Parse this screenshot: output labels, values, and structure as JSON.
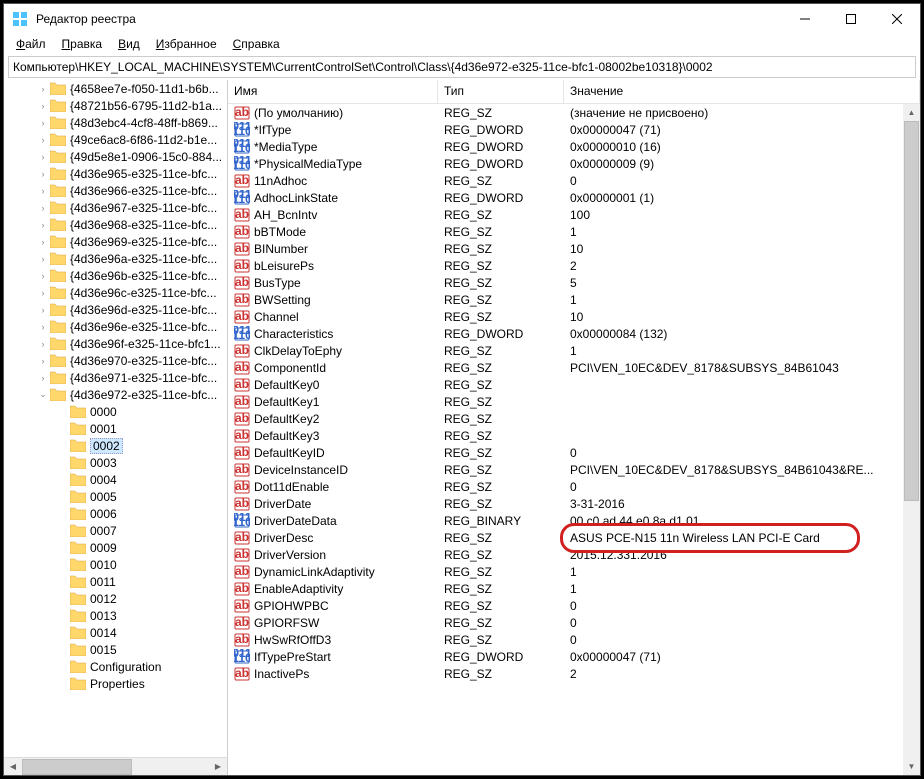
{
  "window": {
    "title": "Редактор реестра"
  },
  "menu": {
    "file": "Файл",
    "edit": "Правка",
    "view": "Вид",
    "favorites": "Избранное",
    "help": "Справка"
  },
  "address": "Компьютер\\HKEY_LOCAL_MACHINE\\SYSTEM\\CurrentControlSet\\Control\\Class\\{4d36e972-e325-11ce-bfc1-08002be10318}\\0002",
  "tree": {
    "folders": [
      "{4658ee7e-f050-11d1-b6b...",
      "{48721b56-6795-11d2-b1a...",
      "{48d3ebc4-4cf8-48ff-b869...",
      "{49ce6ac8-6f86-11d2-b1e...",
      "{49d5e8e1-0906-15c0-884...",
      "{4d36e965-e325-11ce-bfc...",
      "{4d36e966-e325-11ce-bfc...",
      "{4d36e967-e325-11ce-bfc...",
      "{4d36e968-e325-11ce-bfc...",
      "{4d36e969-e325-11ce-bfc...",
      "{4d36e96a-e325-11ce-bfc...",
      "{4d36e96b-e325-11ce-bfc...",
      "{4d36e96c-e325-11ce-bfc...",
      "{4d36e96d-e325-11ce-bfc...",
      "{4d36e96e-e325-11ce-bfc...",
      "{4d36e96f-e325-11ce-bfc1...",
      "{4d36e970-e325-11ce-bfc...",
      "{4d36e971-e325-11ce-bfc...",
      "{4d36e972-e325-11ce-bfc..."
    ],
    "subs": [
      "0000",
      "0001",
      "0002",
      "0003",
      "0004",
      "0005",
      "0006",
      "0007",
      "0009",
      "0010",
      "0011",
      "0012",
      "0013",
      "0014",
      "0015",
      "Configuration",
      "Properties"
    ],
    "selected_sub": "0002"
  },
  "columns": {
    "name": "Имя",
    "type": "Тип",
    "value": "Значение"
  },
  "values": [
    {
      "icon": "sz",
      "name": "(По умолчанию)",
      "type": "REG_SZ",
      "value": "(значение не присвоено)"
    },
    {
      "icon": "dw",
      "name": "*IfType",
      "type": "REG_DWORD",
      "value": "0x00000047 (71)"
    },
    {
      "icon": "dw",
      "name": "*MediaType",
      "type": "REG_DWORD",
      "value": "0x00000010 (16)"
    },
    {
      "icon": "dw",
      "name": "*PhysicalMediaType",
      "type": "REG_DWORD",
      "value": "0x00000009 (9)"
    },
    {
      "icon": "sz",
      "name": "11nAdhoc",
      "type": "REG_SZ",
      "value": "0"
    },
    {
      "icon": "dw",
      "name": "AdhocLinkState",
      "type": "REG_DWORD",
      "value": "0x00000001 (1)"
    },
    {
      "icon": "sz",
      "name": "AH_BcnIntv",
      "type": "REG_SZ",
      "value": "100"
    },
    {
      "icon": "sz",
      "name": "bBTMode",
      "type": "REG_SZ",
      "value": "1"
    },
    {
      "icon": "sz",
      "name": "BINumber",
      "type": "REG_SZ",
      "value": "10"
    },
    {
      "icon": "sz",
      "name": "bLeisurePs",
      "type": "REG_SZ",
      "value": "2"
    },
    {
      "icon": "sz",
      "name": "BusType",
      "type": "REG_SZ",
      "value": "5"
    },
    {
      "icon": "sz",
      "name": "BWSetting",
      "type": "REG_SZ",
      "value": "1"
    },
    {
      "icon": "sz",
      "name": "Channel",
      "type": "REG_SZ",
      "value": "10"
    },
    {
      "icon": "dw",
      "name": "Characteristics",
      "type": "REG_DWORD",
      "value": "0x00000084 (132)"
    },
    {
      "icon": "sz",
      "name": "ClkDelayToEphy",
      "type": "REG_SZ",
      "value": "1"
    },
    {
      "icon": "sz",
      "name": "ComponentId",
      "type": "REG_SZ",
      "value": "PCI\\VEN_10EC&DEV_8178&SUBSYS_84B61043"
    },
    {
      "icon": "sz",
      "name": "DefaultKey0",
      "type": "REG_SZ",
      "value": ""
    },
    {
      "icon": "sz",
      "name": "DefaultKey1",
      "type": "REG_SZ",
      "value": ""
    },
    {
      "icon": "sz",
      "name": "DefaultKey2",
      "type": "REG_SZ",
      "value": ""
    },
    {
      "icon": "sz",
      "name": "DefaultKey3",
      "type": "REG_SZ",
      "value": ""
    },
    {
      "icon": "sz",
      "name": "DefaultKeyID",
      "type": "REG_SZ",
      "value": "0"
    },
    {
      "icon": "sz",
      "name": "DeviceInstanceID",
      "type": "REG_SZ",
      "value": "PCI\\VEN_10EC&DEV_8178&SUBSYS_84B61043&RE..."
    },
    {
      "icon": "sz",
      "name": "Dot11dEnable",
      "type": "REG_SZ",
      "value": "0"
    },
    {
      "icon": "sz",
      "name": "DriverDate",
      "type": "REG_SZ",
      "value": "3-31-2016"
    },
    {
      "icon": "dw",
      "name": "DriverDateData",
      "type": "REG_BINARY",
      "value": "00 c0 ad 44 e0 8a d1 01"
    },
    {
      "icon": "sz",
      "name": "DriverDesc",
      "type": "REG_SZ",
      "value": "ASUS PCE-N15 11n Wireless LAN PCI-E Card"
    },
    {
      "icon": "sz",
      "name": "DriverVersion",
      "type": "REG_SZ",
      "value": "2015.12.331.2016"
    },
    {
      "icon": "sz",
      "name": "DynamicLinkAdaptivity",
      "type": "REG_SZ",
      "value": "1"
    },
    {
      "icon": "sz",
      "name": "EnableAdaptivity",
      "type": "REG_SZ",
      "value": "1"
    },
    {
      "icon": "sz",
      "name": "GPIOHWPBC",
      "type": "REG_SZ",
      "value": "0"
    },
    {
      "icon": "sz",
      "name": "GPIORFSW",
      "type": "REG_SZ",
      "value": "0"
    },
    {
      "icon": "sz",
      "name": "HwSwRfOffD3",
      "type": "REG_SZ",
      "value": "0"
    },
    {
      "icon": "dw",
      "name": "IfTypePreStart",
      "type": "REG_DWORD",
      "value": "0x00000047 (71)"
    },
    {
      "icon": "sz",
      "name": "InactivePs",
      "type": "REG_SZ",
      "value": "2"
    }
  ]
}
